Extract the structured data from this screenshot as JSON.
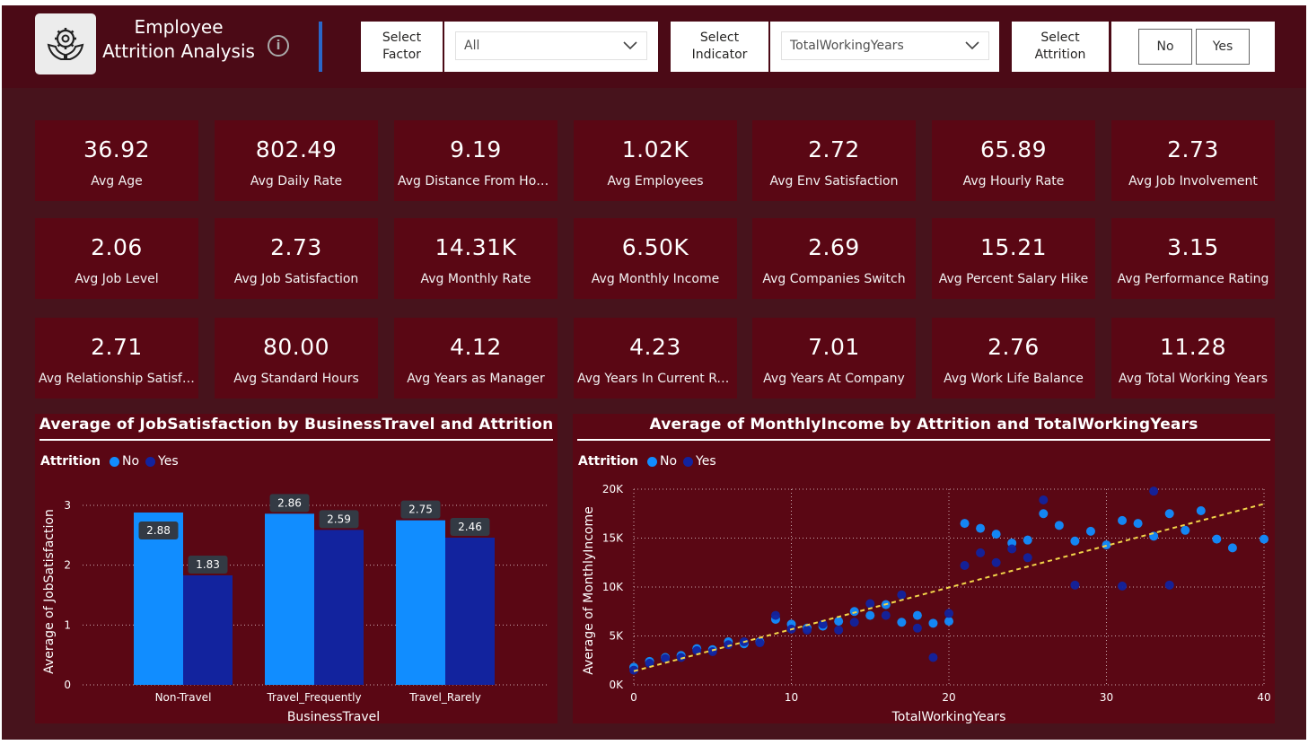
{
  "header": {
    "title_line1": "Employee",
    "title_line2": "Attrition Analysis",
    "info_symbol": "i"
  },
  "filters": {
    "factor": {
      "label_line1": "Select",
      "label_line2": "Factor",
      "value": "All"
    },
    "indicator": {
      "label_line1": "Select",
      "label_line2": "Indicator",
      "value": "TotalWorkingYears"
    },
    "attrition": {
      "label_line1": "Select",
      "label_line2": "Attrition",
      "options": [
        "No",
        "Yes"
      ]
    }
  },
  "kpis": [
    {
      "value": "36.92",
      "label": "Avg Age"
    },
    {
      "value": "802.49",
      "label": "Avg Daily Rate"
    },
    {
      "value": "9.19",
      "label": "Avg Distance From Home"
    },
    {
      "value": "1.02K",
      "label": "Avg Employees"
    },
    {
      "value": "2.72",
      "label": "Avg Env Satisfaction"
    },
    {
      "value": "65.89",
      "label": "Avg Hourly Rate"
    },
    {
      "value": "2.73",
      "label": "Avg Job Involvement"
    },
    {
      "value": "2.06",
      "label": "Avg Job Level"
    },
    {
      "value": "2.73",
      "label": "Avg Job Satisfaction"
    },
    {
      "value": "14.31K",
      "label": "Avg Monthly Rate"
    },
    {
      "value": "6.50K",
      "label": "Avg Monthly Income"
    },
    {
      "value": "2.69",
      "label": "Avg Companies Switch"
    },
    {
      "value": "15.21",
      "label": "Avg Percent Salary Hike"
    },
    {
      "value": "3.15",
      "label": "Avg Performance Rating"
    },
    {
      "value": "2.71",
      "label": "Avg Relationship Satisfa..."
    },
    {
      "value": "80.00",
      "label": "Avg Standard Hours"
    },
    {
      "value": "4.12",
      "label": "Avg Years as Manager"
    },
    {
      "value": "4.23",
      "label": "Avg Years In Current Role"
    },
    {
      "value": "7.01",
      "label": "Avg Years At Company"
    },
    {
      "value": "2.76",
      "label": "Avg Work Life Balance"
    },
    {
      "value": "11.28",
      "label": "Avg Total Working Years"
    }
  ],
  "colors": {
    "no": "#118dff",
    "yes": "#12239e",
    "trend": "#f2d54a",
    "panel": "#5a0714",
    "background": "#47131c"
  },
  "chart_data": [
    {
      "type": "bar",
      "title": "Average of JobSatisfaction by BusinessTravel and Attrition",
      "legend_title": "Attrition",
      "xlabel": "BusinessTravel",
      "ylabel": "Average of JobSatisfaction",
      "categories": [
        "Non-Travel",
        "Travel_Frequently",
        "Travel_Rarely"
      ],
      "series": [
        {
          "name": "No",
          "values": [
            2.88,
            2.86,
            2.75
          ],
          "labels": [
            "2.88",
            "2.86",
            "2.75"
          ]
        },
        {
          "name": "Yes",
          "values": [
            1.83,
            2.59,
            2.46
          ],
          "labels": [
            "1.83",
            "2.59",
            "2.46"
          ]
        }
      ],
      "ylim": [
        0,
        3.3
      ],
      "yticks": [
        0,
        1,
        2,
        3
      ],
      "grid": true,
      "legend": "top-left"
    },
    {
      "type": "scatter",
      "title": "Average of MonthlyIncome by Attrition and TotalWorkingYears",
      "legend_title": "Attrition",
      "xlabel": "TotalWorkingYears",
      "ylabel": "Average of MonthlyIncome",
      "xlim": [
        0,
        40
      ],
      "ylim": [
        0,
        20000
      ],
      "xticks": [
        0,
        10,
        20,
        30,
        40
      ],
      "yticks": [
        {
          "v": 0,
          "label": "0K"
        },
        {
          "v": 5000,
          "label": "5K"
        },
        {
          "v": 10000,
          "label": "10K"
        },
        {
          "v": 15000,
          "label": "15K"
        },
        {
          "v": 20000,
          "label": "20K"
        }
      ],
      "grid": true,
      "legend": "top-left",
      "trendline": {
        "x": [
          0,
          40
        ],
        "y": [
          1400,
          18500
        ]
      },
      "series": [
        {
          "name": "No",
          "points": [
            [
              0,
              1800
            ],
            [
              1,
              2400
            ],
            [
              2,
              2800
            ],
            [
              3,
              3000
            ],
            [
              4,
              3700
            ],
            [
              5,
              3600
            ],
            [
              6,
              4400
            ],
            [
              7,
              4200
            ],
            [
              8,
              4400
            ],
            [
              9,
              6700
            ],
            [
              10,
              6200
            ],
            [
              11,
              5800
            ],
            [
              12,
              6000
            ],
            [
              13,
              6500
            ],
            [
              14,
              7500
            ],
            [
              15,
              7100
            ],
            [
              16,
              8200
            ],
            [
              17,
              6400
            ],
            [
              18,
              7100
            ],
            [
              19,
              6300
            ],
            [
              20,
              6500
            ],
            [
              21,
              16500
            ],
            [
              22,
              16000
            ],
            [
              23,
              15400
            ],
            [
              24,
              14500
            ],
            [
              25,
              14800
            ],
            [
              26,
              17500
            ],
            [
              27,
              16300
            ],
            [
              28,
              14700
            ],
            [
              29,
              15700
            ],
            [
              30,
              14300
            ],
            [
              31,
              16800
            ],
            [
              32,
              16500
            ],
            [
              33,
              15200
            ],
            [
              34,
              17500
            ],
            [
              35,
              15800
            ],
            [
              36,
              17800
            ],
            [
              37,
              14900
            ],
            [
              38,
              14000
            ],
            [
              40,
              14900
            ]
          ]
        },
        {
          "name": "Yes",
          "points": [
            [
              0,
              1500
            ],
            [
              1,
              2200
            ],
            [
              2,
              2700
            ],
            [
              3,
              2800
            ],
            [
              4,
              3500
            ],
            [
              5,
              3400
            ],
            [
              6,
              4100
            ],
            [
              7,
              4400
            ],
            [
              8,
              4300
            ],
            [
              9,
              7100
            ],
            [
              10,
              5700
            ],
            [
              11,
              5600
            ],
            [
              12,
              6200
            ],
            [
              13,
              5600
            ],
            [
              14,
              6400
            ],
            [
              15,
              8300
            ],
            [
              16,
              7100
            ],
            [
              17,
              9200
            ],
            [
              18,
              5800
            ],
            [
              19,
              2800
            ],
            [
              20,
              7300
            ],
            [
              21,
              12200
            ],
            [
              22,
              13500
            ],
            [
              23,
              12500
            ],
            [
              24,
              13900
            ],
            [
              25,
              13000
            ],
            [
              26,
              18900
            ],
            [
              28,
              10200
            ],
            [
              31,
              10100
            ],
            [
              33,
              19800
            ],
            [
              34,
              10200
            ]
          ]
        }
      ]
    }
  ]
}
